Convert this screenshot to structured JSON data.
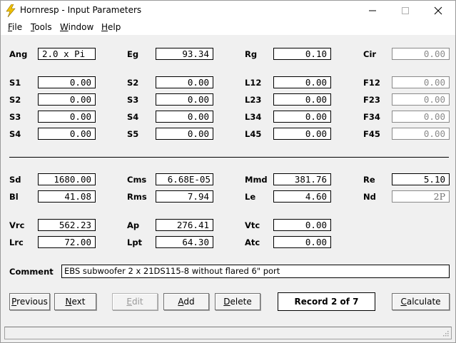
{
  "window": {
    "title": "Hornresp - Input Parameters",
    "icon": "lightning-bolt-icon",
    "controls": [
      "minimize-icon",
      "maximize-icon",
      "close-icon"
    ]
  },
  "menu": [
    {
      "label": "File",
      "mnemonic": "F",
      "rest": "ile"
    },
    {
      "label": "Tools",
      "mnemonic": "T",
      "rest": "ools"
    },
    {
      "label": "Window",
      "mnemonic": "W",
      "rest": "indow"
    },
    {
      "label": "Help",
      "mnemonic": "H",
      "rest": "elp"
    }
  ],
  "params": {
    "Ang": {
      "label": "Ang",
      "value": "2.0 x Pi"
    },
    "Eg": {
      "label": "Eg",
      "value": "93.34"
    },
    "Rg": {
      "label": "Rg",
      "value": "0.10"
    },
    "Cir": {
      "label": "Cir",
      "value": "0.00"
    },
    "S1": {
      "label": "S1",
      "value": "0.00"
    },
    "S2a": {
      "label": "S2",
      "value": "0.00"
    },
    "S3a": {
      "label": "S3",
      "value": "0.00"
    },
    "S4a": {
      "label": "S4",
      "value": "0.00"
    },
    "S2b": {
      "label": "S2",
      "value": "0.00"
    },
    "S3b": {
      "label": "S3",
      "value": "0.00"
    },
    "S4b": {
      "label": "S4",
      "value": "0.00"
    },
    "S5": {
      "label": "S5",
      "value": "0.00"
    },
    "L12": {
      "label": "L12",
      "value": "0.00"
    },
    "L23": {
      "label": "L23",
      "value": "0.00"
    },
    "L34": {
      "label": "L34",
      "value": "0.00"
    },
    "L45": {
      "label": "L45",
      "value": "0.00"
    },
    "F12": {
      "label": "F12",
      "value": "0.00"
    },
    "F23": {
      "label": "F23",
      "value": "0.00"
    },
    "F34": {
      "label": "F34",
      "value": "0.00"
    },
    "F45": {
      "label": "F45",
      "value": "0.00"
    },
    "Sd": {
      "label": "Sd",
      "value": "1680.00"
    },
    "Bl": {
      "label": "Bl",
      "value": "41.08"
    },
    "Cms": {
      "label": "Cms",
      "value": "6.68E-05"
    },
    "Rms": {
      "label": "Rms",
      "value": "7.94"
    },
    "Mmd": {
      "label": "Mmd",
      "value": "381.76"
    },
    "Le": {
      "label": "Le",
      "value": "4.60"
    },
    "Re": {
      "label": "Re",
      "value": "5.10"
    },
    "Nd": {
      "label": "Nd",
      "value": "2P"
    },
    "Vrc": {
      "label": "Vrc",
      "value": "562.23"
    },
    "Lrc": {
      "label": "Lrc",
      "value": "72.00"
    },
    "Ap": {
      "label": "Ap",
      "value": "276.41"
    },
    "Lpt": {
      "label": "Lpt",
      "value": "64.30"
    },
    "Vtc": {
      "label": "Vtc",
      "value": "0.00"
    },
    "Atc": {
      "label": "Atc",
      "value": "0.00"
    }
  },
  "comment": {
    "label": "Comment",
    "value": "EBS subwoofer 2 x 21DS115-8 without flared 6\" port"
  },
  "buttons": {
    "previous": {
      "label": "Previous",
      "mnemonic": "P",
      "rest": "revious"
    },
    "next": {
      "label": "Next",
      "mnemonic": "N",
      "rest": "ext"
    },
    "edit": {
      "label": "Edit",
      "mnemonic": "E",
      "rest": "dit"
    },
    "add": {
      "label": "Add",
      "mnemonic": "A",
      "rest": "dd"
    },
    "delete": {
      "label": "Delete",
      "mnemonic": "D",
      "rest": "elete"
    },
    "calculate": {
      "label": "Calculate",
      "mnemonic": "C",
      "rest": "alculate"
    }
  },
  "record": "Record 2 of 7",
  "colors": {
    "accent_bolt": "#f2c200",
    "background": "#f0f0f0"
  }
}
